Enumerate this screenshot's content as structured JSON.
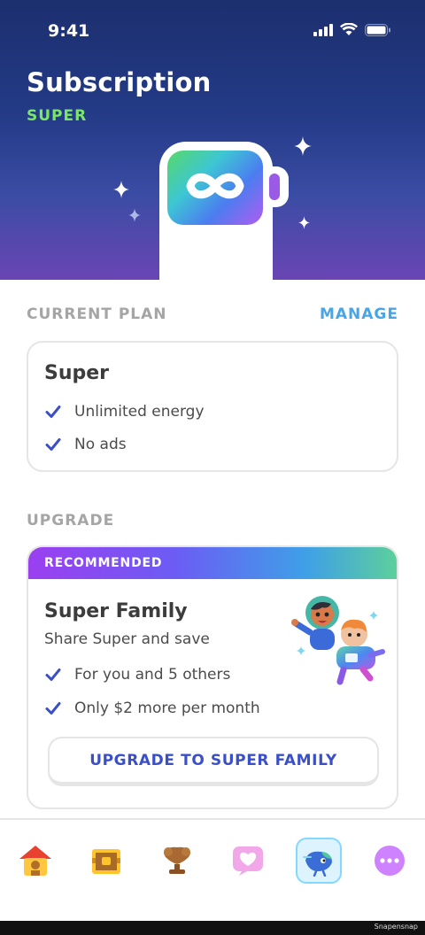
{
  "status_bar": {
    "time": "9:41"
  },
  "header": {
    "title": "Subscription",
    "plan_tag": "SUPER"
  },
  "current_plan": {
    "heading": "CURRENT PLAN",
    "manage_label": "MANAGE",
    "card_title": "Super",
    "features": [
      "Unlimited energy",
      "No ads"
    ]
  },
  "upgrade": {
    "heading": "UPGRADE",
    "ribbon": "RECOMMENDED",
    "card_title": "Super Family",
    "subtitle": "Share Super and save",
    "features": [
      "For you and 5 others",
      "Only $2 more per month"
    ],
    "button_label": "UPGRADE TO SUPER FAMILY"
  },
  "nav": {
    "items": [
      {
        "icon": "home-icon"
      },
      {
        "icon": "treasure-chest-icon"
      },
      {
        "icon": "trophy-icon"
      },
      {
        "icon": "heart-icon"
      },
      {
        "icon": "super-character-icon",
        "active": true
      },
      {
        "icon": "more-icon"
      }
    ]
  },
  "footer": {
    "watermark": "Snapensnap"
  },
  "colors": {
    "accent_green": "#79e66a",
    "link_blue": "#48a5e6",
    "button_text": "#3b4fc6",
    "check": "#3b4fc6"
  }
}
